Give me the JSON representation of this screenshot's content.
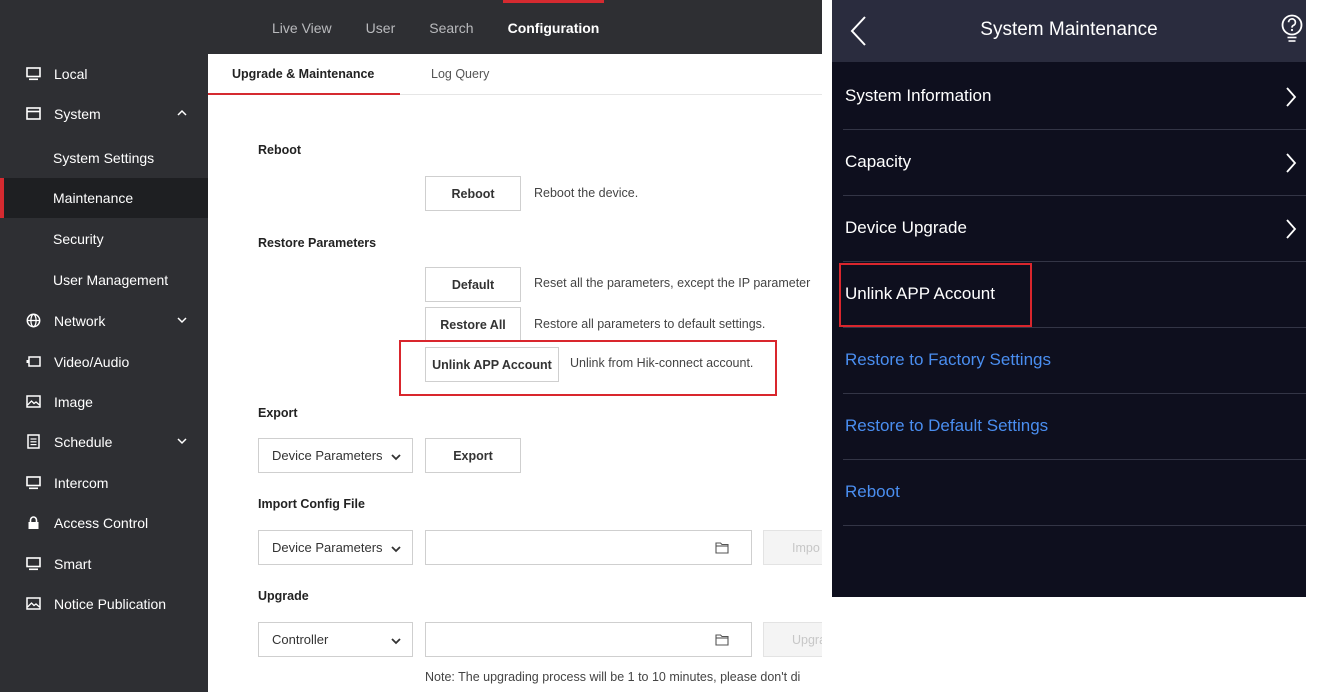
{
  "topnav": {
    "items": [
      {
        "label": "Live View"
      },
      {
        "label": "User"
      },
      {
        "label": "Search"
      },
      {
        "label": "Configuration"
      }
    ]
  },
  "sidebar": {
    "local": "Local",
    "system": "System",
    "system_settings": "System Settings",
    "maintenance": "Maintenance",
    "security": "Security",
    "user_management": "User Management",
    "network": "Network",
    "video_audio": "Video/Audio",
    "image": "Image",
    "schedule": "Schedule",
    "intercom": "Intercom",
    "access_control": "Access Control",
    "smart": "Smart",
    "notice_publication": "Notice Publication"
  },
  "tabs": {
    "upgrade_maintenance": "Upgrade & Maintenance",
    "log_query": "Log Query"
  },
  "reboot": {
    "title": "Reboot",
    "button": "Reboot",
    "desc": "Reboot the device."
  },
  "restore": {
    "title": "Restore Parameters",
    "default_button": "Default",
    "default_desc": "Reset all the parameters, except the IP parameter",
    "restore_all_button": "Restore All",
    "restore_all_desc": "Restore all parameters to default settings.",
    "unlink_button": "Unlink APP Account",
    "unlink_desc": "Unlink from Hik-connect account."
  },
  "export": {
    "title": "Export",
    "select_value": "Device Parameters",
    "button": "Export"
  },
  "import": {
    "title": "Import Config File",
    "select_value": "Device Parameters",
    "button": "Impo"
  },
  "upgrade": {
    "title": "Upgrade",
    "select_value": "Controller",
    "button": "Upgra",
    "note": "Note: The upgrading process will be 1 to 10 minutes, please don't di"
  },
  "mobile": {
    "title": "System Maintenance",
    "rows": [
      {
        "label": "System Information"
      },
      {
        "label": "Capacity"
      },
      {
        "label": "Device Upgrade"
      },
      {
        "label": "Unlink APP Account"
      },
      {
        "label": "Restore to Factory Settings"
      },
      {
        "label": "Restore to Default Settings"
      },
      {
        "label": "Reboot"
      }
    ]
  },
  "colors": {
    "accent_red": "#d52a30",
    "sidebar_bg": "#2e2f33",
    "mobile_bg": "#0e0f1e",
    "mobile_header_bg": "#2a2c3e",
    "mobile_link_blue": "#4a8ef0",
    "highlight_box": "#d9262d"
  },
  "icons": {
    "back": "chevron-left-icon",
    "help": "help-bulb-icon",
    "row_arrow": "chevron-right-icon",
    "folder": "folder-icon"
  }
}
